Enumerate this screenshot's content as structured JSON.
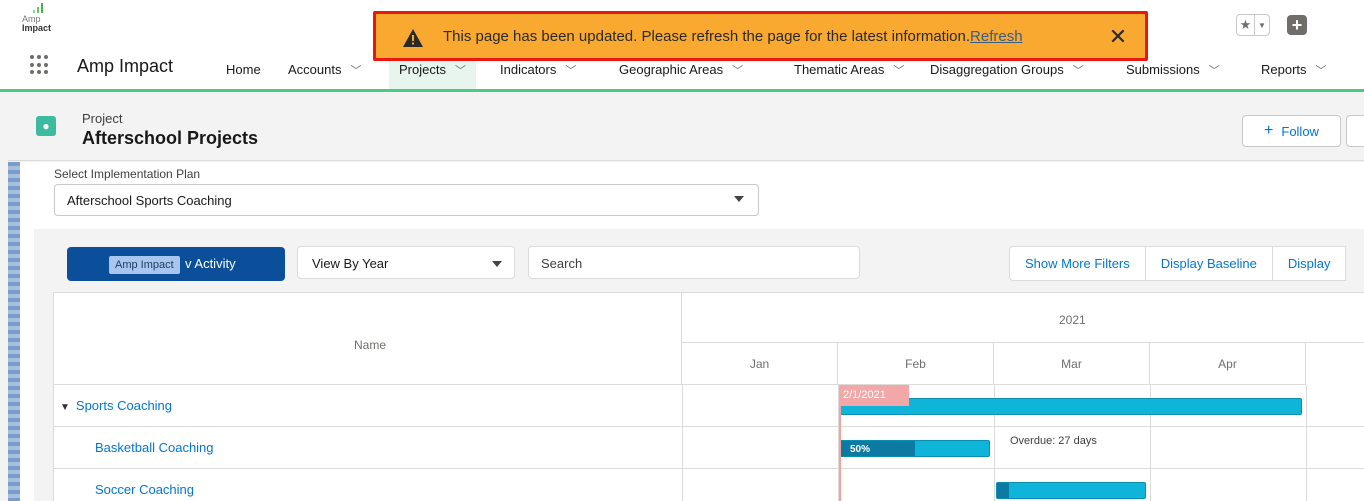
{
  "app": {
    "logo_line1": "Amp",
    "logo_line2": "Impact",
    "name": "Amp Impact"
  },
  "toast": {
    "message": "This page has been updated. Please refresh the page for the latest information.",
    "link": "Refresh",
    "close_icon": "close-icon",
    "warning_icon": "warning-icon"
  },
  "header_icons": {
    "favorite": "star-icon",
    "favorite_menu": "chevron-down-icon",
    "add": "plus-icon"
  },
  "nav": {
    "items": [
      {
        "label": "Home",
        "chevron": false
      },
      {
        "label": "Accounts",
        "chevron": true
      },
      {
        "label": "Projects",
        "chevron": true,
        "active": true
      },
      {
        "label": "Indicators",
        "chevron": true
      },
      {
        "label": "Geographic Areas",
        "chevron": true
      },
      {
        "label": "Thematic Areas",
        "chevron": true
      },
      {
        "label": "Disaggregation Groups",
        "chevron": true
      },
      {
        "label": "Submissions",
        "chevron": true
      },
      {
        "label": "Reports",
        "chevron": true
      }
    ]
  },
  "record": {
    "type": "Project",
    "title": "Afterschool Projects",
    "follow_label": "Follow"
  },
  "plan": {
    "label": "Select Implementation Plan",
    "value": "Afterschool Sports Coaching"
  },
  "toolbar": {
    "new_activity_label": "v Activity",
    "tooltip": "Amp Impact",
    "view_select": "View By Year",
    "search_placeholder": "Search",
    "buttons": [
      "Show More Filters",
      "Display Baseline",
      "Display"
    ]
  },
  "gantt": {
    "name_header": "Name",
    "year": "2021",
    "months": [
      "Jan",
      "Feb",
      "Mar",
      "Apr"
    ],
    "today_badge": "2/1/2021",
    "rows": [
      {
        "name": "Sports Coaching",
        "level": 1,
        "expanded": true
      },
      {
        "name": "Basketball Coaching",
        "level": 2,
        "progress_label": "50%",
        "progress": 0.5,
        "note": "Overdue: 27 days"
      },
      {
        "name": "Soccer Coaching",
        "level": 2,
        "progress": 0.08
      }
    ]
  },
  "colors": {
    "toast_bg": "#f9a830",
    "toast_border": "#e8180e",
    "nav_accent": "#4bca81",
    "primary_button": "#0b4f9b",
    "bar": "#0fb5d8",
    "bar_progress": "#0c7aa1",
    "today": "#f2a8a8",
    "link": "#0176d3"
  }
}
